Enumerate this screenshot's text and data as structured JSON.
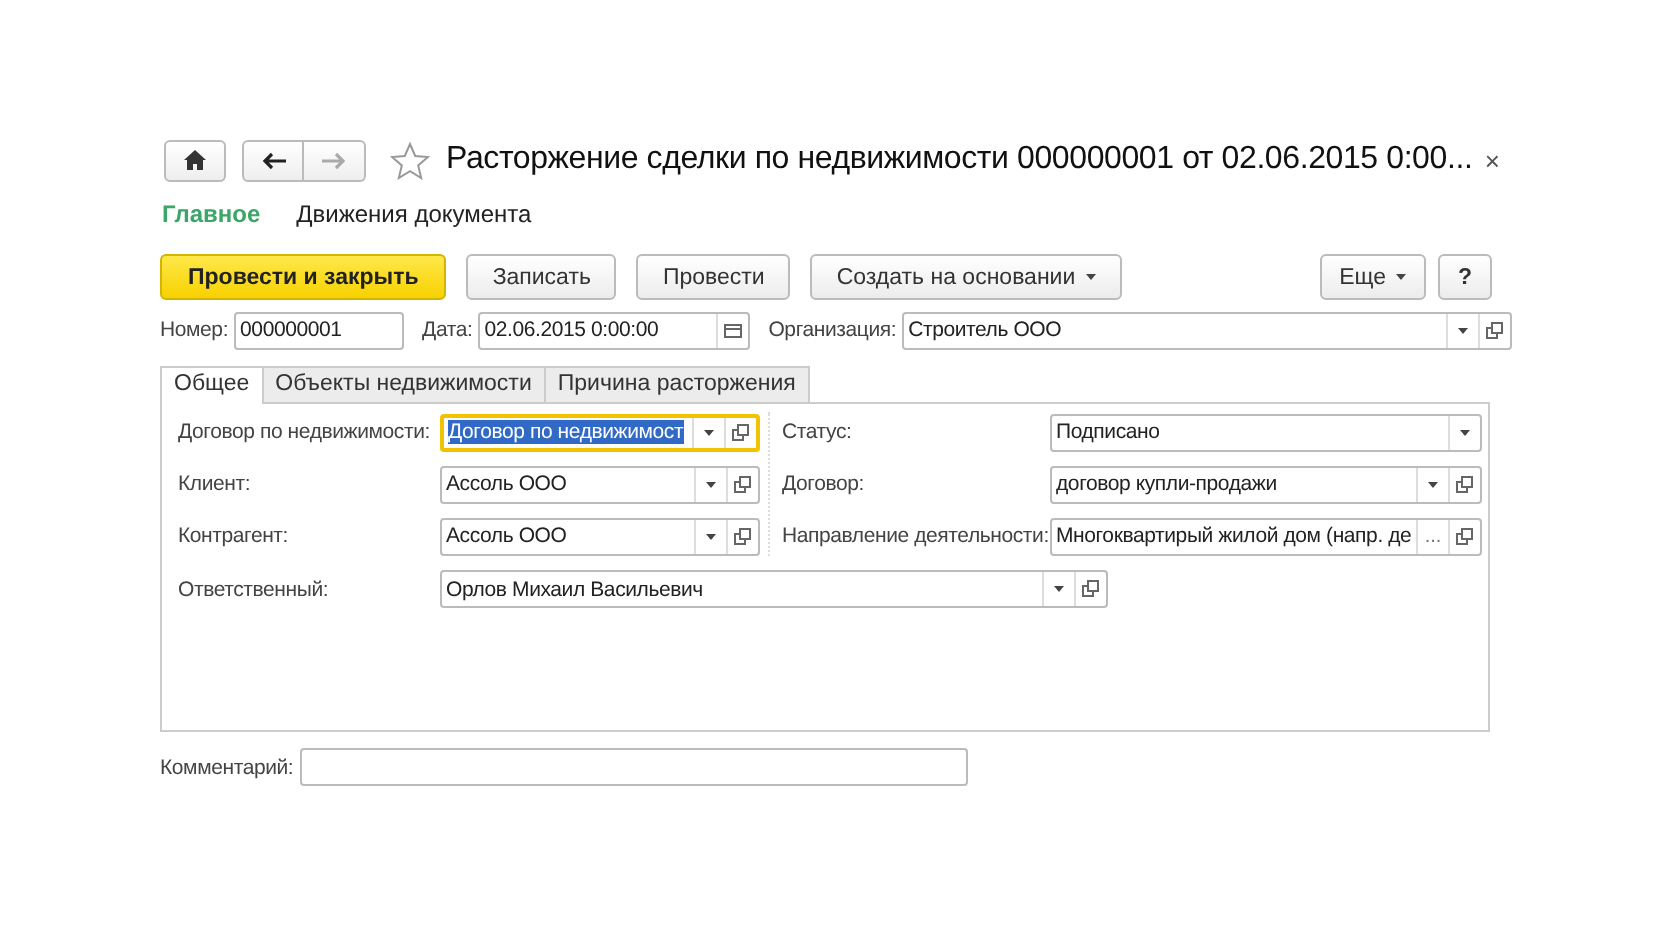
{
  "window": {
    "title": "Расторжение сделки по недвижимости 000000001 от 02.06.2015 0:00...",
    "close": "×"
  },
  "nav_tabs": [
    {
      "label": "Главное",
      "selected": true
    },
    {
      "label": "Движения документа",
      "selected": false
    }
  ],
  "toolbar": [
    {
      "label": "Провести и закрыть",
      "kind": "primary"
    },
    {
      "label": "Записать",
      "kind": "plain"
    },
    {
      "label": "Провести",
      "kind": "plain"
    },
    {
      "label": "Создать на основании",
      "kind": "dropdown"
    }
  ],
  "toolbar_right": [
    {
      "label": "Еще",
      "kind": "dropdown"
    },
    {
      "label": "?",
      "kind": "plain"
    }
  ],
  "header": {
    "number_label": "Номер:",
    "number": "000000001",
    "date_label": "Дата:",
    "date": "02.06.2015  0:00:00",
    "org_label": "Организация:",
    "org": "Строитель ООО"
  },
  "tabs": [
    {
      "label": "Общее",
      "selected": true
    },
    {
      "label": "Объекты недвижимости",
      "selected": false
    },
    {
      "label": "Причина расторжения",
      "selected": false
    }
  ],
  "left_fields": [
    {
      "label": "Договор по недвижимости:",
      "value": "Договор по недвижимост",
      "kind": "select_open",
      "focused": true
    },
    {
      "label": "Клиент:",
      "value": "Ассоль ООО",
      "kind": "select_open",
      "focused": false
    },
    {
      "label": "Контрагент:",
      "value": "Ассоль ООО",
      "kind": "select_open",
      "focused": false
    }
  ],
  "right_fields": [
    {
      "label": "Статус:",
      "value": "Подписано",
      "kind": "select",
      "focused": false
    },
    {
      "label": "Договор:",
      "value": "договор купли-продажи",
      "kind": "select_open",
      "focused": false
    },
    {
      "label": "Направление деятельности:",
      "value": "Многоквартирый жилой дом (напр. де",
      "kind": "choose_open",
      "choose": "...",
      "focused": false
    }
  ],
  "responsible": {
    "label": "Ответственный:",
    "value": "Орлов Михаил Васильевич",
    "kind": "select_open",
    "focused": false
  },
  "comment": {
    "label": "Комментарий:"
  }
}
